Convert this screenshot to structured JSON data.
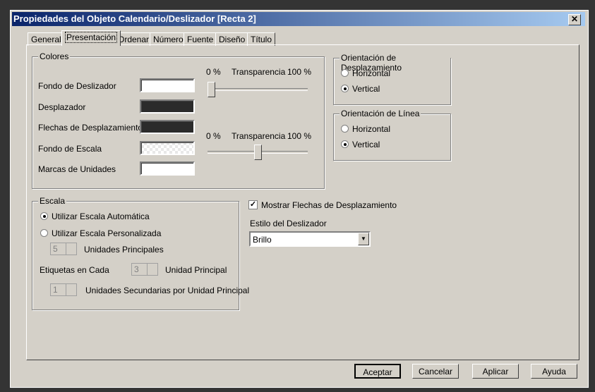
{
  "title": "Propiedades del Objeto Calendario/Deslizador [Recta 2]",
  "tabs": [
    "General",
    "Presentación",
    "Ordenar",
    "Número",
    "Fuente",
    "Diseño",
    "Título"
  ],
  "colors": {
    "legend": "Colores",
    "items": [
      "Fondo de Deslizador",
      "Desplazador",
      "Flechas de Desplazamiento",
      "Fondo de Escala",
      "Marcas de Unidades"
    ],
    "swatches": [
      "#ffffff",
      "#2b2b2b",
      "#2b2b2b",
      "checker",
      "#ffffff"
    ],
    "slider1": {
      "min": "0 %",
      "label": "Transparencia",
      "max": "100 %",
      "value": 0
    },
    "slider2": {
      "min": "0 %",
      "label": "Transparencia",
      "max": "100 %",
      "value": 50
    }
  },
  "orient_scroll": {
    "legend": "Orientación de Desplazamiento",
    "options": [
      "Horizontal",
      "Vertical"
    ],
    "selected": 1
  },
  "orient_line": {
    "legend": "Orientación de Línea",
    "options": [
      "Horizontal",
      "Vertical"
    ],
    "selected": 1
  },
  "scale": {
    "legend": "Escala",
    "auto": "Utilizar Escala Automática",
    "custom": "Utilizar Escala Personalizada",
    "major_value": "5",
    "major_label": "Unidades Principales",
    "labels_label": "Etiquetas en Cada",
    "labels_value": "3",
    "labels_unit": "Unidad Principal",
    "minor_value": "1",
    "minor_label": "Unidades Secundarias por Unidad Principal"
  },
  "show_arrows": {
    "label": "Mostrar Flechas de Desplazamiento",
    "checked": true
  },
  "style": {
    "label": "Estilo del Deslizador",
    "value": "Brillo"
  },
  "buttons": {
    "ok": "Aceptar",
    "cancel": "Cancelar",
    "apply": "Aplicar",
    "help": "Ayuda"
  }
}
